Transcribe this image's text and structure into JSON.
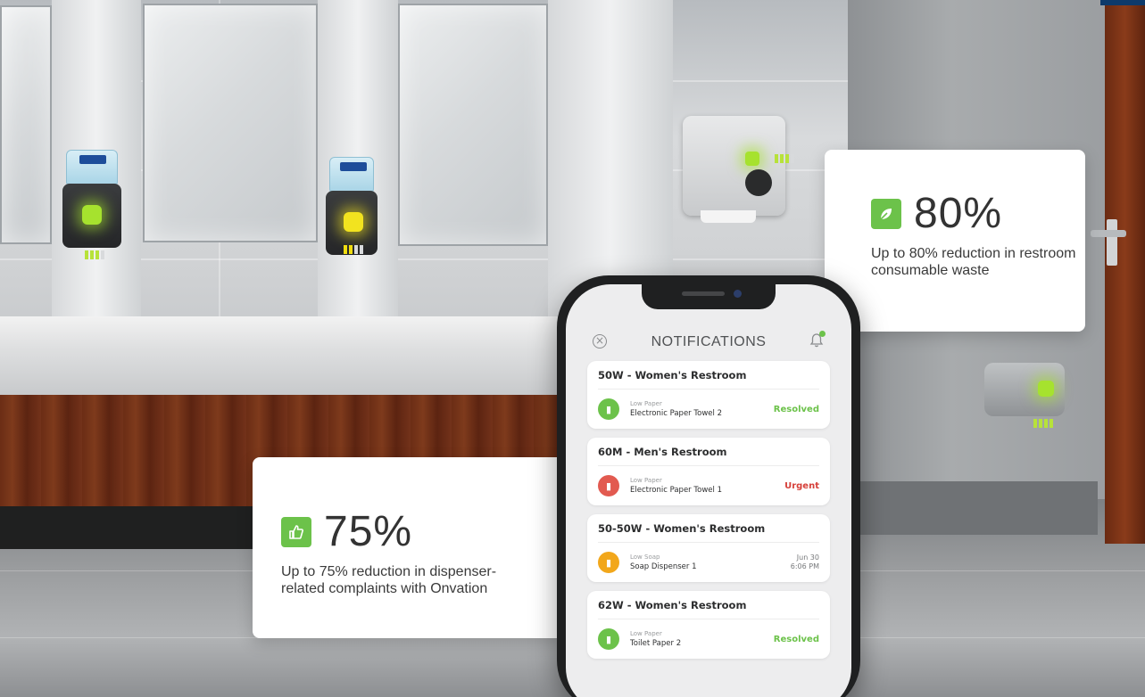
{
  "stats": [
    {
      "percent": "80%",
      "description": "Up to 80% reduction in restroom consumable waste",
      "icon": "leaf-icon"
    },
    {
      "percent": "75%",
      "description": "Up to 75% reduction in dispenser-related complaints with Onvation",
      "icon": "thumbs-up-icon"
    }
  ],
  "phone": {
    "title": "NOTIFICATIONS",
    "notifications": [
      {
        "location": "50W - Women's Restroom",
        "type": "Low Paper",
        "device": "Electronic Paper Towel 2",
        "status": "Resolved",
        "status_color": "#6cc24a",
        "icon_color": "#6cc24a"
      },
      {
        "location": "60M - Men's Restroom",
        "type": "Low Paper",
        "device": "Electronic Paper Towel 1",
        "status": "Urgent",
        "status_color": "#d6403a",
        "icon_color": "#e25a50"
      },
      {
        "location": "50-50W - Women's Restroom",
        "type": "Low Soap",
        "device": "Soap Dispenser 1",
        "date": "Jun 30",
        "time": "6:06 PM",
        "icon_color": "#f2a71b"
      },
      {
        "location": "62W - Women's Restroom",
        "type": "Low Paper",
        "device": "Toilet Paper 2",
        "status": "Resolved",
        "status_color": "#6cc24a",
        "icon_color": "#6cc24a"
      }
    ]
  },
  "colors": {
    "accent": "#6cc24a",
    "urgent": "#d6403a",
    "pending": "#f2a71b"
  }
}
